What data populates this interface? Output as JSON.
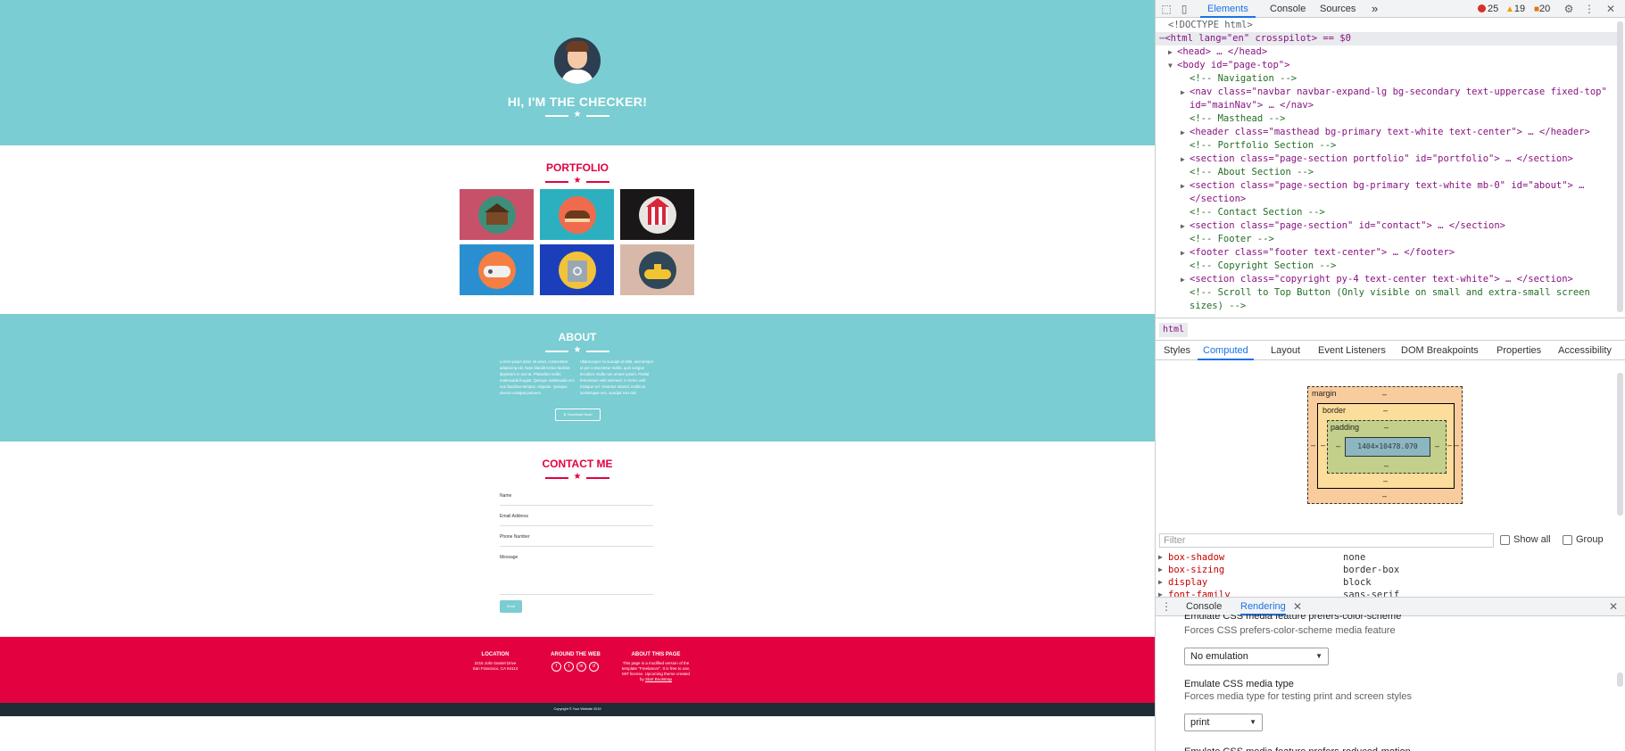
{
  "site": {
    "masthead": {
      "title": "HI, I'M THE CHECKER!"
    },
    "portfolio": {
      "title": "PORTFOLIO"
    },
    "about": {
      "title": "ABOUT",
      "col1": "Lorem ipsum dolor sit amet, consectetur adipiscing elit. Nam blandit lectus facilisis dignissim in sed at. Phasellus mollis malesuada feugiat. Quisque malesuada orci non faucibus tempus. Aliquam. Quisque viverra volutpat posuere.",
      "col2": "Ullamcorper mi suscipit id nibh, sed tempor ut per consectetur mollis, quis congue tincidunt. Nulla non ornare ipsum. Partial fermentum velit euismod. In lorem velit tristique vel. Vivamus etiamd, mollis at, scelerisque nec, suscipit non nisl.",
      "button": "Download Now!"
    },
    "contact": {
      "title": "CONTACT ME",
      "fields": [
        "Name",
        "Email Address",
        "Phone Number",
        "Message"
      ],
      "send": "Send"
    },
    "footer": {
      "location_title": "LOCATION",
      "location_line1": "2215 John Daniel Drive",
      "location_line2": "San Francisco, CA 94114",
      "web_title": "AROUND THE WEB",
      "social": [
        "f",
        "t",
        "in",
        "d"
      ],
      "about_title": "ABOUT THIS PAGE",
      "about_text": "This page is a modified version of the template \"Freelancer\". It is free to use, MIT license. Upcoming theme created by",
      "about_link": "Start Bootstrap"
    },
    "copyright": "Copyright © Your Website 2019"
  },
  "devtools": {
    "tabs": [
      "Elements",
      "Console",
      "Sources"
    ],
    "more_tabs": "»",
    "errors": "25",
    "warnings": "19",
    "issues": "20",
    "elements": [
      {
        "kind": "doctype",
        "text": "<!DOCTYPE html>"
      },
      {
        "kind": "html",
        "text": "<html lang=\"en\" crosspilot> == $0"
      },
      {
        "kind": "node",
        "text": "<head> … </head>"
      },
      {
        "kind": "node",
        "text": "<body id=\"page-top\">"
      },
      {
        "kind": "comment",
        "text": "<!-- Navigation -->"
      },
      {
        "kind": "node",
        "text": "<nav class=\"navbar navbar-expand-lg bg-secondary text-uppercase fixed-top\""
      },
      {
        "kind": "cont",
        "text": "id=\"mainNav\"> … </nav>"
      },
      {
        "kind": "comment",
        "text": "<!-- Masthead -->"
      },
      {
        "kind": "node",
        "text": "<header class=\"masthead bg-primary text-white text-center\"> … </header>"
      },
      {
        "kind": "comment",
        "text": "<!-- Portfolio Section -->"
      },
      {
        "kind": "node",
        "text": "<section class=\"page-section portfolio\" id=\"portfolio\"> … </section>"
      },
      {
        "kind": "comment",
        "text": "<!-- About Section -->"
      },
      {
        "kind": "node",
        "text": "<section class=\"page-section bg-primary text-white mb-0\" id=\"about\"> …"
      },
      {
        "kind": "cont",
        "text": "</section>"
      },
      {
        "kind": "comment",
        "text": "<!-- Contact Section -->"
      },
      {
        "kind": "node",
        "text": "<section class=\"page-section\" id=\"contact\"> … </section>"
      },
      {
        "kind": "comment",
        "text": "<!-- Footer -->"
      },
      {
        "kind": "node",
        "text": "<footer class=\"footer text-center\"> … </footer>"
      },
      {
        "kind": "comment",
        "text": "<!-- Copyright Section -->"
      },
      {
        "kind": "node",
        "text": "<section class=\"copyright py-4 text-center text-white\"> … </section>"
      },
      {
        "kind": "comment",
        "text": "<!-- Scroll to Top Button (Only visible on small and extra-small screen"
      },
      {
        "kind": "comment",
        "text": "sizes) -->"
      }
    ],
    "breadcrumb": "html",
    "subtabs": [
      "Styles",
      "Computed",
      "Layout",
      "Event Listeners",
      "DOM Breakpoints",
      "Properties",
      "Accessibility"
    ],
    "boxmodel": {
      "margin": "margin",
      "border": "border",
      "padding": "padding",
      "content": "1404×10478.070",
      "dash": "–"
    },
    "filter_placeholder": "Filter",
    "show_all": "Show all",
    "group": "Group",
    "computed": [
      {
        "name": "box-shadow",
        "value": "none"
      },
      {
        "name": "box-sizing",
        "value": "border-box"
      },
      {
        "name": "display",
        "value": "block"
      },
      {
        "name": "font-family",
        "value": "sans-serif"
      }
    ],
    "drawer_tabs": [
      "Console",
      "Rendering"
    ],
    "rendering": {
      "sec1_title": "Emulate CSS media feature prefers-color-scheme",
      "sec1_desc": "Forces CSS prefers-color-scheme media feature",
      "sec1_value": "No emulation",
      "sec2_title": "Emulate CSS media type",
      "sec2_desc": "Forces media type for testing print and screen styles",
      "sec2_value": "print",
      "sec3_title": "Emulate CSS media feature prefers-reduced-motion"
    }
  }
}
